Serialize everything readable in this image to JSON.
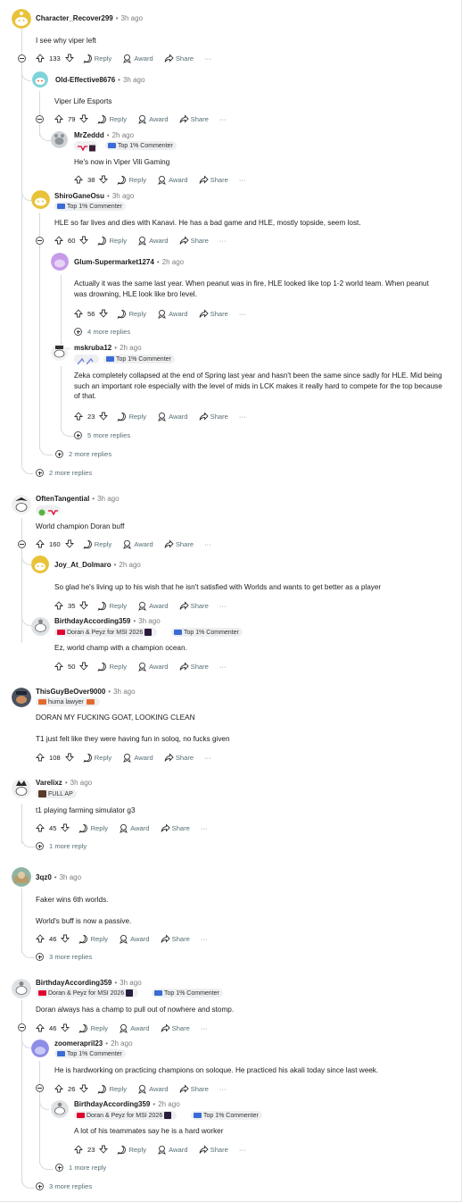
{
  "labels": {
    "reply": "Reply",
    "award": "Award",
    "share": "Share",
    "more": "···",
    "top_commenter": "Top 1% Commenter"
  },
  "comments": {
    "c1": {
      "user": "Character_Recover299",
      "time": "3h ago",
      "text": "I see why viper left",
      "votes": "133"
    },
    "c2": {
      "user": "Old-Effective8676",
      "time": "3h ago",
      "text": "Viper Life Esports",
      "votes": "79"
    },
    "c3": {
      "user": "MrZeddd",
      "time": "2h ago",
      "text": "He's now in Viper Vili Gaming",
      "votes": "38"
    },
    "c4": {
      "user": "ShiroGaneOsu",
      "time": "3h ago",
      "text": "HLE so far lives and dies with Kanavi. He has a bad game and HLE, mostly topside, seem lost.",
      "votes": "60"
    },
    "c5": {
      "user": "Glum-Supermarket1274",
      "time": "2h ago",
      "text": "Actually it was the same last year. When peanut was in fire, HLE looked like top 1-2 world team. When peanut was drowning, HLE look like bro level.",
      "votes": "56"
    },
    "c6": {
      "user": "mskruba12",
      "time": "2h ago",
      "text": "Zeka completely collapsed at the end of Spring last year and hasn't been the same since sadly for HLE. Mid being such an important role especially with the level of mids in LCK makes it really hard to compete for the top because of that.",
      "votes": "23"
    },
    "c7": {
      "user": "OftenTangential",
      "time": "3h ago",
      "text": "World champion Doran buff",
      "votes": "160"
    },
    "c8": {
      "user": "Joy_At_Dolmaro",
      "time": "2h ago",
      "text": "So glad he's living up to his wish that he isn't satisfied with Worlds and wants to get better as a player",
      "votes": "35"
    },
    "c9": {
      "user": "BirthdayAccording359",
      "time": "3h ago",
      "flair": "Doran & Peyz for MSI 2026",
      "text": "Ez, world champ with a champion ocean.",
      "votes": "50"
    },
    "c10": {
      "user": "ThisGuyBeOver9000",
      "time": "3h ago",
      "flair": "huma lawyer",
      "text": "DORAN MY FUCKING GOAT, LOOKING CLEAN",
      "text2": "T1 just felt like they were having fun in soloq, no fucks given",
      "votes": "108"
    },
    "c11": {
      "user": "Varelixz",
      "time": "3h ago",
      "flair": "FULL AP",
      "text": "t1 playing farming simulator g3",
      "votes": "45"
    },
    "c12": {
      "user": "3qz0",
      "time": "3h ago",
      "text": "Faker wins 6th worlds.",
      "text2": "World's buff is now a passive.",
      "votes": "46"
    },
    "c13": {
      "user": "BirthdayAccording359",
      "time": "3h ago",
      "flair": "Doran & Peyz for MSI 2026",
      "text": "Doran always has a champ to pull out of nowhere and stomp.",
      "votes": "46"
    },
    "c14": {
      "user": "zoomerapril23",
      "time": "2h ago",
      "text": "He is hardworking on practicing champions on soloque. He practiced his akali today since last week.",
      "votes": "26"
    },
    "c15": {
      "user": "BirthdayAccording359",
      "time": "2h ago",
      "flair": "Doran & Peyz for MSI 2026",
      "text": "A lot of his teammates say he is a hard worker",
      "votes": "23"
    }
  },
  "more_replies": {
    "m1": "4 more replies",
    "m2": "5 more replies",
    "m3": "2 more replies",
    "m4": "2 more replies",
    "m5": "1 more reply",
    "m6": "3 more replies",
    "m7": "1 more reply",
    "m8": "3 more replies"
  }
}
